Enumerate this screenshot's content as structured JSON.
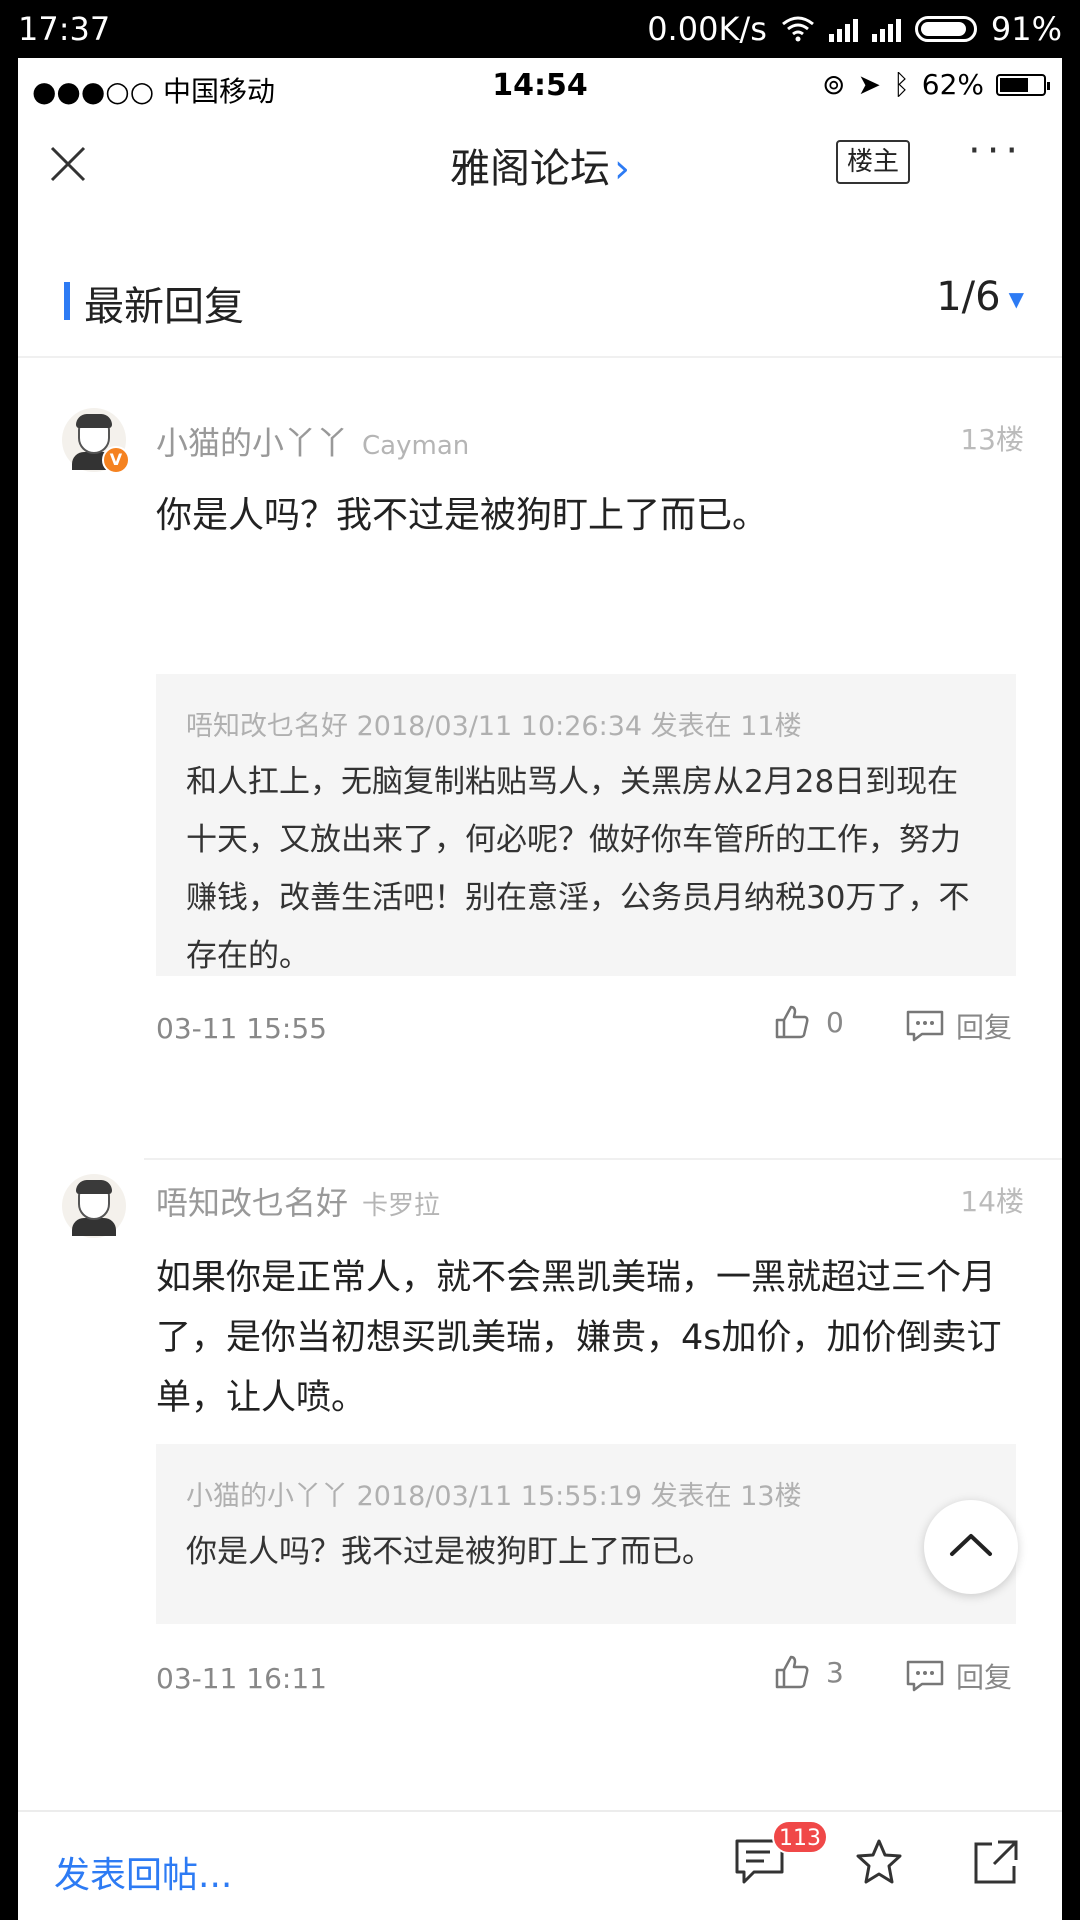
{
  "device_status": {
    "time": "17:37",
    "speed": "0.00K/s",
    "battery": "91%"
  },
  "ios_status": {
    "carrier": "●●●○○ 中国移动",
    "clock": "14:54",
    "battery": "62%"
  },
  "nav": {
    "title": "雅阁论坛",
    "chevron": "›",
    "op_label": "楼主",
    "more": "···"
  },
  "section": {
    "label": "最新回复",
    "pager": "1/6",
    "pager_arrow": "▼"
  },
  "posts": [
    {
      "username": "小猫的小丫丫",
      "car": "Cayman",
      "floor": "13楼",
      "content": "你是人吗？我不过是被狗盯上了而已。",
      "quote_meta": "唔知改乜名好 2018/03/11 10:26:34 发表在 11楼",
      "quote_text": "和人扛上，无脑复制粘贴骂人，关黑房从2月28日到现在十天，又放出来了，何必呢？做好你车管所的工作，努力赚钱，改善生活吧！别在意淫，公务员月纳税30万了，不存在的。",
      "time": "03-11 15:55",
      "likes": "0",
      "reply_label": "回复",
      "verified_badge": "V"
    },
    {
      "username": "唔知改乜名好",
      "car": "卡罗拉",
      "floor": "14楼",
      "content": "如果你是正常人，就不会黑凯美瑞，一黑就超过三个月了，是你当初想买凯美瑞，嫌贵，4s加价，加价倒卖订单，让人喷。",
      "quote_meta": "小猫的小丫丫 2018/03/11 15:55:19 发表在 13楼",
      "quote_text": "你是人吗？我不过是被狗盯上了而已。",
      "time": "03-11 16:11",
      "likes": "3",
      "reply_label": "回复"
    }
  ],
  "bottom": {
    "compose": "发表回帖...",
    "comment_count": "113"
  },
  "colors": {
    "accent": "#2d7bf4",
    "badge": "#f04848",
    "verified": "#f58220"
  }
}
